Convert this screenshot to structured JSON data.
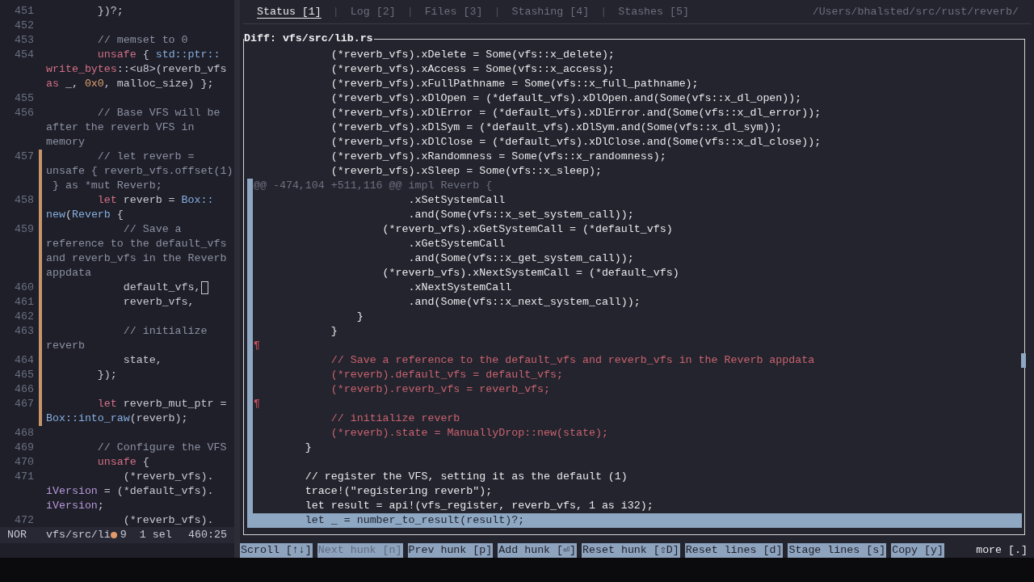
{
  "editor": {
    "lines": [
      {
        "number": "451",
        "modified": false,
        "cursor": false,
        "rows": [
          {
            "tokens": [
              {
                "kind": "plain",
                "text": "        })?;"
              }
            ]
          }
        ]
      },
      {
        "number": "452",
        "modified": false,
        "cursor": false
      },
      {
        "number": "453",
        "modified": false,
        "cursor": false,
        "rows": [
          {
            "tokens": [
              {
                "kind": "comment",
                "text": "        // memset to 0"
              }
            ]
          }
        ]
      },
      {
        "number": "454",
        "modified": false,
        "cursor": false,
        "rows": [
          {
            "tokens": [
              {
                "kind": "keyword",
                "text": "        unsafe"
              },
              {
                "kind": "plain",
                "text": " { "
              },
              {
                "kind": "type",
                "text": "std::ptr::"
              }
            ]
          },
          {
            "tokens": [
              {
                "kind": "keyword",
                "text": "write_bytes"
              },
              {
                "kind": "plain",
                "text": "::<u8>(reverb_vfs"
              }
            ]
          },
          {
            "tokens": [
              {
                "kind": "keyword",
                "text": "as"
              },
              {
                "kind": "plain",
                "text": " _, "
              },
              {
                "kind": "number",
                "text": "0x0"
              },
              {
                "kind": "plain",
                "text": ", malloc_size) };"
              }
            ]
          }
        ]
      },
      {
        "number": "455",
        "modified": false,
        "cursor": false
      },
      {
        "number": "456",
        "modified": false,
        "cursor": false,
        "rows": [
          {
            "tokens": [
              {
                "kind": "comment",
                "text": "        // Base VFS will be"
              }
            ]
          },
          {
            "tokens": [
              {
                "kind": "comment",
                "text": "after the reverb VFS in"
              }
            ]
          },
          {
            "tokens": [
              {
                "kind": "comment",
                "text": "memory"
              }
            ]
          }
        ]
      },
      {
        "number": "457",
        "modified": true,
        "cursor": false,
        "rows": [
          {
            "tokens": [
              {
                "kind": "comment",
                "text": "        // let reverb ="
              }
            ]
          },
          {
            "tokens": [
              {
                "kind": "comment",
                "text": "unsafe { reverb_vfs.offset(1)"
              }
            ]
          },
          {
            "tokens": [
              {
                "kind": "comment",
                "text": " } as *mut Reverb;"
              }
            ]
          }
        ]
      },
      {
        "number": "458",
        "modified": true,
        "cursor": false,
        "rows": [
          {
            "tokens": [
              {
                "kind": "keyword",
                "text": "        let"
              },
              {
                "kind": "plain",
                "text": " reverb = "
              },
              {
                "kind": "type",
                "text": "Box::"
              }
            ]
          },
          {
            "tokens": [
              {
                "kind": "type",
                "text": "new"
              },
              {
                "kind": "plain",
                "text": "("
              },
              {
                "kind": "type",
                "text": "Reverb"
              },
              {
                "kind": "plain",
                "text": " {"
              }
            ]
          }
        ]
      },
      {
        "number": "459",
        "modified": true,
        "cursor": false,
        "rows": [
          {
            "tokens": [
              {
                "kind": "comment",
                "text": "            // Save a"
              }
            ]
          },
          {
            "tokens": [
              {
                "kind": "comment",
                "text": "reference to the default_vfs"
              }
            ]
          },
          {
            "tokens": [
              {
                "kind": "comment",
                "text": "and reverb_vfs in the Reverb"
              }
            ]
          },
          {
            "tokens": [
              {
                "kind": "comment",
                "text": "appdata"
              }
            ]
          }
        ]
      },
      {
        "number": "460",
        "modified": true,
        "cursor": true,
        "rows": [
          {
            "tokens": [
              {
                "kind": "plain",
                "text": "            default_vfs,"
              }
            ]
          }
        ]
      },
      {
        "number": "461",
        "modified": true,
        "cursor": false,
        "rows": [
          {
            "tokens": [
              {
                "kind": "plain",
                "text": "            reverb_vfs,"
              }
            ]
          }
        ]
      },
      {
        "number": "462",
        "modified": true,
        "cursor": false
      },
      {
        "number": "463",
        "modified": true,
        "cursor": false,
        "rows": [
          {
            "tokens": [
              {
                "kind": "comment",
                "text": "            // initialize"
              }
            ]
          },
          {
            "tokens": [
              {
                "kind": "comment",
                "text": "reverb"
              }
            ]
          }
        ]
      },
      {
        "number": "464",
        "modified": true,
        "cursor": false,
        "rows": [
          {
            "tokens": [
              {
                "kind": "plain",
                "text": "            state,"
              }
            ]
          }
        ]
      },
      {
        "number": "465",
        "modified": true,
        "cursor": false,
        "rows": [
          {
            "tokens": [
              {
                "kind": "plain",
                "text": "        });"
              }
            ]
          }
        ]
      },
      {
        "number": "466",
        "modified": true,
        "cursor": false
      },
      {
        "number": "467",
        "modified": true,
        "cursor": false,
        "rows": [
          {
            "tokens": [
              {
                "kind": "keyword",
                "text": "        let"
              },
              {
                "kind": "plain",
                "text": " reverb_mut_ptr ="
              }
            ]
          },
          {
            "tokens": [
              {
                "kind": "type",
                "text": "Box::into_raw"
              },
              {
                "kind": "plain",
                "text": "(reverb);"
              }
            ]
          }
        ]
      },
      {
        "number": "468",
        "modified": false,
        "cursor": false
      },
      {
        "number": "469",
        "modified": false,
        "cursor": false,
        "rows": [
          {
            "tokens": [
              {
                "kind": "comment",
                "text": "        // Configure the VFS"
              }
            ]
          }
        ]
      },
      {
        "number": "470",
        "modified": false,
        "cursor": false,
        "rows": [
          {
            "tokens": [
              {
                "kind": "keyword",
                "text": "        unsafe"
              },
              {
                "kind": "plain",
                "text": " {"
              }
            ]
          }
        ]
      },
      {
        "number": "471",
        "modified": false,
        "cursor": false,
        "rows": [
          {
            "tokens": [
              {
                "kind": "plain",
                "text": "            (*reverb_vfs)."
              }
            ]
          },
          {
            "tokens": [
              {
                "kind": "field",
                "text": "iVersion"
              },
              {
                "kind": "plain",
                "text": " = (*default_vfs)."
              }
            ]
          },
          {
            "tokens": [
              {
                "kind": "field",
                "text": "iVersion"
              },
              {
                "kind": "plain",
                "text": ";"
              }
            ]
          }
        ]
      },
      {
        "number": "472",
        "modified": false,
        "cursor": false,
        "rows": [
          {
            "tokens": [
              {
                "kind": "plain",
                "text": "            (*reverb_vfs)."
              }
            ]
          }
        ]
      }
    ]
  },
  "status_bar": {
    "mode": "NOR",
    "file": "vfs/src/li",
    "modified": true,
    "diagnostics": "9",
    "selections": "1 sel",
    "position": "460:25"
  },
  "tabs": [
    {
      "label": "Status [1]",
      "selected": true
    },
    {
      "label": "Log [2]",
      "selected": false
    },
    {
      "label": "Files [3]",
      "selected": false
    },
    {
      "label": "Stashing [4]",
      "selected": false
    },
    {
      "label": "Stashes [5]",
      "selected": false
    }
  ],
  "tab_separator": "|",
  "repo_path": "/Users/bhalsted/src/rust/reverb/",
  "diff": {
    "title": "Diff: vfs/src/lib.rs",
    "context_before": [
      "            (*reverb_vfs).xDelete = Some(vfs::x_delete);",
      "            (*reverb_vfs).xAccess = Some(vfs::x_access);",
      "            (*reverb_vfs).xFullPathname = Some(vfs::x_full_pathname);",
      "            (*reverb_vfs).xDlOpen = (*default_vfs).xDlOpen.and(Some(vfs::x_dl_open));",
      "            (*reverb_vfs).xDlError = (*default_vfs).xDlError.and(Some(vfs::x_dl_error));",
      "            (*reverb_vfs).xDlSym = (*default_vfs).xDlSym.and(Some(vfs::x_dl_sym));",
      "            (*reverb_vfs).xDlClose = (*default_vfs).xDlClose.and(Some(vfs::x_dl_close));",
      "            (*reverb_vfs).xRandomness = Some(vfs::x_randomness);",
      "            (*reverb_vfs).xSleep = Some(vfs::x_sleep);"
    ],
    "hunk": {
      "header": "@@ -474,104 +511,116 @@ impl Reverb {",
      "lines": [
        {
          "kind": "context",
          "selected": false,
          "text": "                        .xSetSystemCall"
        },
        {
          "kind": "context",
          "selected": false,
          "text": "                        .and(Some(vfs::x_set_system_call));"
        },
        {
          "kind": "context",
          "selected": false,
          "text": "                    (*reverb_vfs).xGetSystemCall = (*default_vfs)"
        },
        {
          "kind": "context",
          "selected": false,
          "text": "                        .xGetSystemCall"
        },
        {
          "kind": "context",
          "selected": false,
          "text": "                        .and(Some(vfs::x_get_system_call));"
        },
        {
          "kind": "context",
          "selected": false,
          "text": "                    (*reverb_vfs).xNextSystemCall = (*default_vfs)"
        },
        {
          "kind": "context",
          "selected": false,
          "text": "                        .xNextSystemCall"
        },
        {
          "kind": "context",
          "selected": false,
          "text": "                        .and(Some(vfs::x_next_system_call));"
        },
        {
          "kind": "context",
          "selected": false,
          "text": "                }"
        },
        {
          "kind": "context",
          "selected": false,
          "text": "            }"
        },
        {
          "kind": "marker",
          "selected": false,
          "text": "¶"
        },
        {
          "kind": "removed",
          "selected": false,
          "text": "            // Save a reference to the default_vfs and reverb_vfs in the Reverb appdata"
        },
        {
          "kind": "removed",
          "selected": false,
          "text": "            (*reverb).default_vfs = default_vfs;"
        },
        {
          "kind": "removed",
          "selected": false,
          "text": "            (*reverb).reverb_vfs = reverb_vfs;"
        },
        {
          "kind": "marker",
          "selected": false,
          "text": "¶"
        },
        {
          "kind": "removed",
          "selected": false,
          "text": "            // initialize reverb"
        },
        {
          "kind": "removed",
          "selected": false,
          "text": "            (*reverb).state = ManuallyDrop::new(state);"
        },
        {
          "kind": "context",
          "selected": false,
          "text": "        }"
        },
        {
          "kind": "blank",
          "selected": false
        },
        {
          "kind": "context",
          "selected": false,
          "text": "        // register the VFS, setting it as the default (1)"
        },
        {
          "kind": "context",
          "selected": false,
          "text": "        trace!(\"registering reverb\");"
        },
        {
          "kind": "context",
          "selected": false,
          "text": "        let result = api!(vfs_register, reverb_vfs, 1 as i32);"
        },
        {
          "kind": "context",
          "selected": true,
          "text": "        let _ = number_to_result(result)?;"
        }
      ]
    }
  },
  "commands": [
    {
      "label": "Scroll [↑↓]",
      "disabled": false
    },
    {
      "label": "Next hunk [n]",
      "disabled": true
    },
    {
      "label": "Prev hunk [p]",
      "disabled": false
    },
    {
      "label": "Add hunk [⏎]",
      "disabled": false
    },
    {
      "label": "Reset hunk [⇧D]",
      "disabled": false
    },
    {
      "label": "Reset lines [d]",
      "disabled": false
    },
    {
      "label": "Stage lines [s]",
      "disabled": false
    },
    {
      "label": "Copy [y]",
      "disabled": false
    }
  ],
  "more": "more [.]"
}
